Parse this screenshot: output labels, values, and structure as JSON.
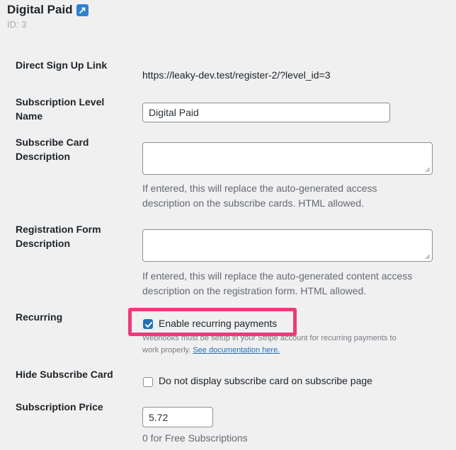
{
  "header": {
    "title": "Digital Paid",
    "id_text": "ID: 3",
    "external_icon": "external-link-icon",
    "external_icon_color": "#2f80d0"
  },
  "fields": {
    "signup_link": {
      "label": "Direct Sign Up Link",
      "value": "https://leaky-dev.test/register-2/?level_id=3"
    },
    "level_name": {
      "label_line1": "Subscription Level",
      "label_line2": "Name",
      "value": "Digital Paid"
    },
    "card_description": {
      "label_line1": "Subscribe Card",
      "label_line2": "Description",
      "value": "",
      "help_line1": "If entered, this will replace the auto-generated access",
      "help_line2": "description on the subscribe cards. HTML allowed."
    },
    "form_description": {
      "label_line1": "Registration Form",
      "label_line2": "Description",
      "value": "",
      "help_line1": "If entered, this will replace the auto-generated content access",
      "help_line2": "description on the registration form. HTML allowed."
    },
    "recurring": {
      "label": "Recurring",
      "checkbox_label": "Enable recurring payments",
      "checked": true,
      "note_obscured": "Webhooks must be setup in your Stripe account for recurring payments to",
      "note_line2": "work properly.",
      "doc_link": "See documentation here."
    },
    "hide_card": {
      "label": "Hide Subscribe Card",
      "checkbox_label": "Do not display subscribe card on subscribe page",
      "checked": false
    },
    "price": {
      "label": "Subscription Price",
      "value": "5.72",
      "help": "0 for Free Subscriptions"
    }
  },
  "colors": {
    "background": "#f0f0f1",
    "highlight": "#ec3b7a",
    "checkbox_checked": "#2271b1",
    "link": "#2271b1"
  }
}
